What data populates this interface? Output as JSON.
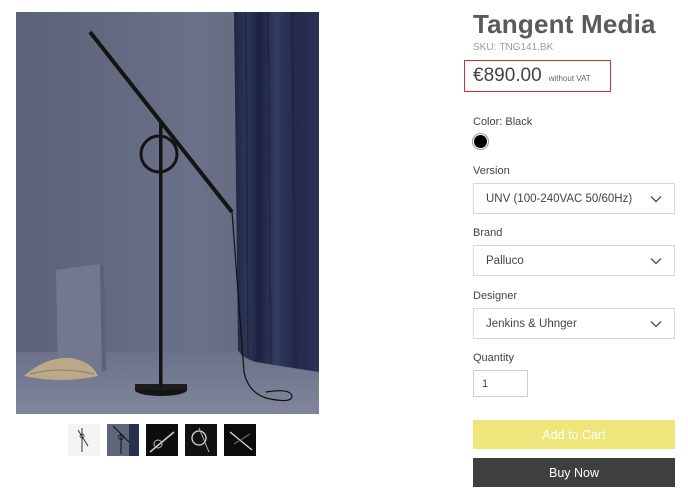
{
  "product": {
    "title": "Tangent Media",
    "sku_label": "SKU:",
    "sku_value": "TNG141.BK",
    "price": "€890.00",
    "price_note": "without VAT"
  },
  "color": {
    "label": "Color: Black",
    "swatch_color": "#000000"
  },
  "options": {
    "version": {
      "label": "Version",
      "value": "UNV (100-240VAC 50/60Hz)"
    },
    "brand": {
      "label": "Brand",
      "value": "Palluco"
    },
    "designer": {
      "label": "Designer",
      "value": "Jenkins & Uhnger"
    }
  },
  "quantity": {
    "label": "Quantity",
    "value": "1"
  },
  "buttons": {
    "add_to_cart": "Add to Cart",
    "buy_now": "Buy Now"
  },
  "colors": {
    "price_highlight_border": "#d42f2f",
    "add_to_cart_bg": "#eee67a",
    "buy_now_bg": "#3f3f3f"
  },
  "gallery": {
    "thumbnail_count": 5,
    "selected_index": 1
  }
}
